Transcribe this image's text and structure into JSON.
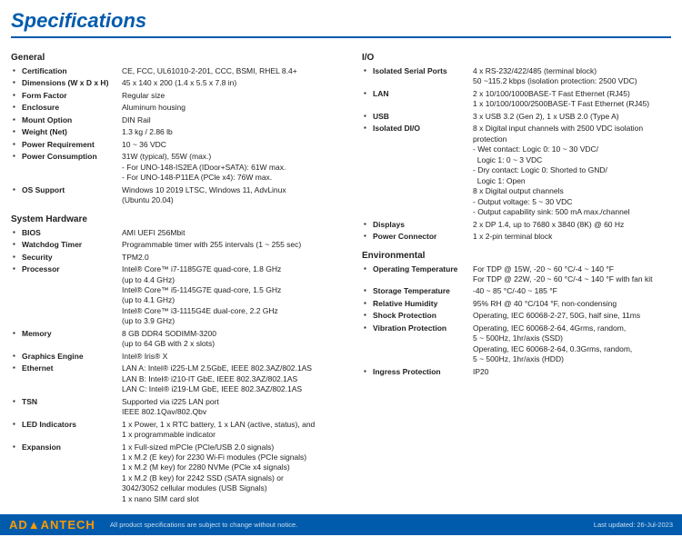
{
  "title": "Specifications",
  "left": {
    "general": {
      "title": "General",
      "rows": [
        {
          "label": "Certification",
          "value": "CE, FCC, UL61010-2-201, CCC, BSMI, RHEL 8.4+"
        },
        {
          "label": "Dimensions (W x D x H)",
          "value": "45 x 140 x 200 (1.4 x 5.5 x 7.8 in)"
        },
        {
          "label": "Form Factor",
          "value": "Regular size"
        },
        {
          "label": "Enclosure",
          "value": "Aluminum housing"
        },
        {
          "label": "Mount Option",
          "value": "DIN Rail"
        },
        {
          "label": "Weight (Net)",
          "value": "1.3 kg / 2.86 lb"
        },
        {
          "label": "Power Requirement",
          "value": "10 ~ 36 VDC"
        },
        {
          "label": "Power Consumption",
          "value": "31W (typical), 55W (max.)\n- For UNO-148-IS2EA (IDoor+SATA): 61W max.\n- For UNO-148-P11EA (PCle x4): 76W max."
        }
      ]
    },
    "os_support": {
      "label": "OS Support",
      "value": "Windows 10 2019 LTSC, Windows 11, AdvLinux\n(Ubuntu 20.04)"
    },
    "system_hardware": {
      "title": "System Hardware",
      "rows": [
        {
          "label": "BIOS",
          "value": "AMI UEFI 256Mbit"
        },
        {
          "label": "Watchdog Timer",
          "value": "Programmable timer with 255 intervals (1 ~ 255 sec)"
        },
        {
          "label": "Security",
          "value": "TPM2.0"
        },
        {
          "label": "Processor",
          "value": "Intel® Core™ i7-1185G7E quad-core, 1.8 GHz\n(up to 4.4 GHz)\nIntel® Core™ i5-1145G7E quad-core, 1.5 GHz\n(up to 4.1 GHz)\nIntel® Core™ i3-1115G4E dual-core, 2.2 GHz\n(up to 3.9 GHz)"
        },
        {
          "label": "Memory",
          "value": "8 GB DDR4 SODIMM-3200\n(up to 64 GB with 2 x slots)"
        },
        {
          "label": "Graphics Engine",
          "value": "Intel® Iris® X"
        },
        {
          "label": "Ethernet",
          "value": "LAN A: Intel® i225-LM 2.5GbE, IEEE 802.3AZ/802.1AS\nLAN B: Intel® i210-IT GbE, IEEE 802.3AZ/802.1AS\nLAN C: Intel® i219-LM GbE, IEEE 802.3AZ/802.1AS"
        },
        {
          "label": "TSN",
          "value": "Supported via i225 LAN port\nIEEE 802.1Qav/802.Qbv"
        },
        {
          "label": "LED Indicators",
          "value": "1 x Power, 1 x RTC battery, 1 x LAN (active, status), and\n1 x programmable indicator"
        },
        {
          "label": "Expansion",
          "value": "1 x Full-sized mPCle (PCle/USB 2.0 signals)\n1 x M.2 (E key) for 2230 Wi-Fi modules (PCIe signals)\n1 x M.2 (M key) for 2280 NVMe (PCle x4 signals)\n1 x M.2 (B key) for 2242 SSD (SATA signals) or\n3042/3052 cellular modules (USB Signals)\n1 x nano SIM card slot"
        }
      ]
    }
  },
  "right": {
    "io": {
      "title": "I/O",
      "rows": [
        {
          "label": "Isolated Serial Ports",
          "value": "4 x RS-232/422/485 (terminal block)\n50 ~115.2 kbps (isolation protection: 2500 VDC)"
        },
        {
          "label": "LAN",
          "value": "2 x 10/100/1000BASE-T Fast Ethernet (RJ45)\n1 x 10/100/1000/2500BASE-T Fast Ethernet (RJ45)"
        },
        {
          "label": "USB",
          "value": "3 x USB 3.2 (Gen 2), 1 x USB 2.0 (Type A)"
        },
        {
          "label": "Isolated DI/O",
          "value": "8 x Digital input channels with 2500 VDC isolation\nprotection\n- Wet contact: Logic 0: 10 ~ 30 VDC/\n  Logic 1: 0 ~ 3 VDC\n- Dry contact: Logic 0: Shorted to GND/\n  Logic 1: Open\n8 x Digital output channels\n- Output voltage: 5 ~ 30 VDC\n- Output capability sink: 500 mA max./channel"
        },
        {
          "label": "Displays",
          "value": "2 x DP 1.4, up to 7680 x 3840 (8K) @ 60 Hz"
        },
        {
          "label": "Power Connector",
          "value": "1 x 2-pin terminal block"
        }
      ]
    },
    "environmental": {
      "title": "Environmental",
      "rows": [
        {
          "label": "Operating Temperature",
          "value": "For TDP @ 15W, -20 ~ 60 °C/-4 ~ 140 °F\nFor TDP @ 22W, -20 ~ 60 °C/-4 ~ 140 °F with fan kit"
        },
        {
          "label": "Storage Temperature",
          "value": "-40 ~ 85 °C/-40 ~ 185 °F"
        },
        {
          "label": "Relative Humidity",
          "value": "95% RH @ 40 °C/104 °F, non-condensing"
        },
        {
          "label": "Shock Protection",
          "value": "Operating, IEC 60068-2-27, 50G, half sine, 11ms"
        },
        {
          "label": "Vibration Protection",
          "value": "Operating, IEC 60068-2-64, 4Grms, random,\n5 ~ 500Hz, 1hr/axis (SSD)\nOperating, IEC 60068-2-64, 0.3Grms, random,\n5 ~ 500Hz, 1hr/axis (HDD)"
        },
        {
          "label": "Ingress Protection",
          "value": "IP20"
        }
      ]
    }
  },
  "footer": {
    "logo_prefix": "AD",
    "logo_brand": "ANTECH",
    "note": "All product specifications are subject to change without notice.",
    "date": "Last updated: 26-Jul-2023"
  }
}
